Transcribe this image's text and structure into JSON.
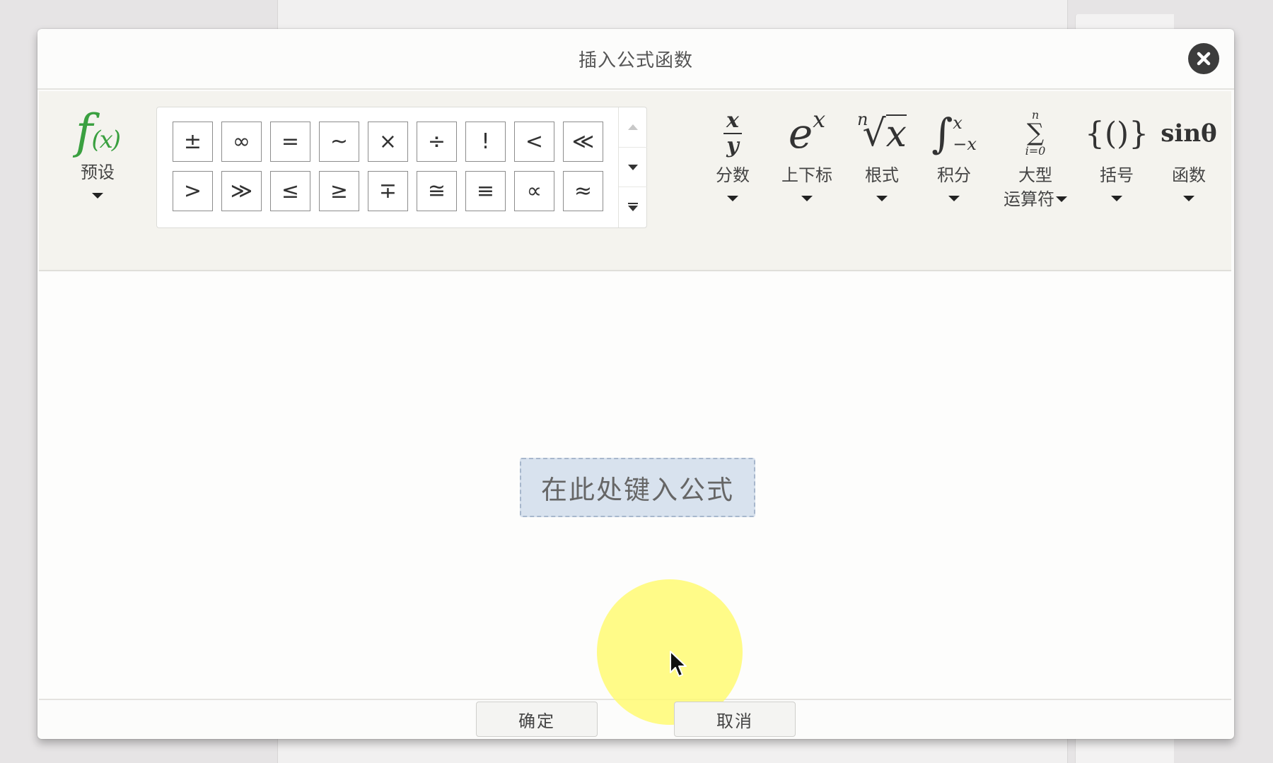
{
  "dialog": {
    "title": "插入公式函数",
    "close_icon": "close-circle-icon"
  },
  "toolbar": {
    "preset": {
      "icon_text": "f",
      "icon_sub": "(x)",
      "label": "预设"
    },
    "symbols": {
      "row1": [
        "±",
        "∞",
        "=",
        "~",
        "×",
        "÷",
        "!",
        "<",
        "≪"
      ],
      "row2": [
        ">",
        "≫",
        "≤",
        "≥",
        "∓",
        "≅",
        "≡",
        "∝",
        "≈"
      ]
    },
    "tools": [
      {
        "key": "fraction",
        "label": "分数"
      },
      {
        "key": "script",
        "label": "上下标"
      },
      {
        "key": "radical",
        "label": "根式"
      },
      {
        "key": "integral",
        "label": "积分"
      },
      {
        "key": "large_operator",
        "label": "大型",
        "label2": "运算符"
      },
      {
        "key": "bracket",
        "label": "括号"
      },
      {
        "key": "function",
        "label": "函数"
      }
    ],
    "icons": {
      "fraction_num": "x",
      "fraction_den": "y",
      "script_base": "e",
      "script_sup": "x",
      "radical_index": "n",
      "radical_base": "x",
      "integral_upper": "x",
      "integral_lower": "−x",
      "sum_upper": "n",
      "sum_lower": "i=0",
      "bracket": "{()}",
      "function": "sinθ"
    }
  },
  "editor": {
    "placeholder": "在此处键入公式"
  },
  "footer": {
    "ok_label": "确定",
    "cancel_label": "取消"
  },
  "colors": {
    "preset_green": "#3aa040",
    "highlight_yellow": "#fffa6e",
    "input_bg": "#d8e2ee"
  }
}
